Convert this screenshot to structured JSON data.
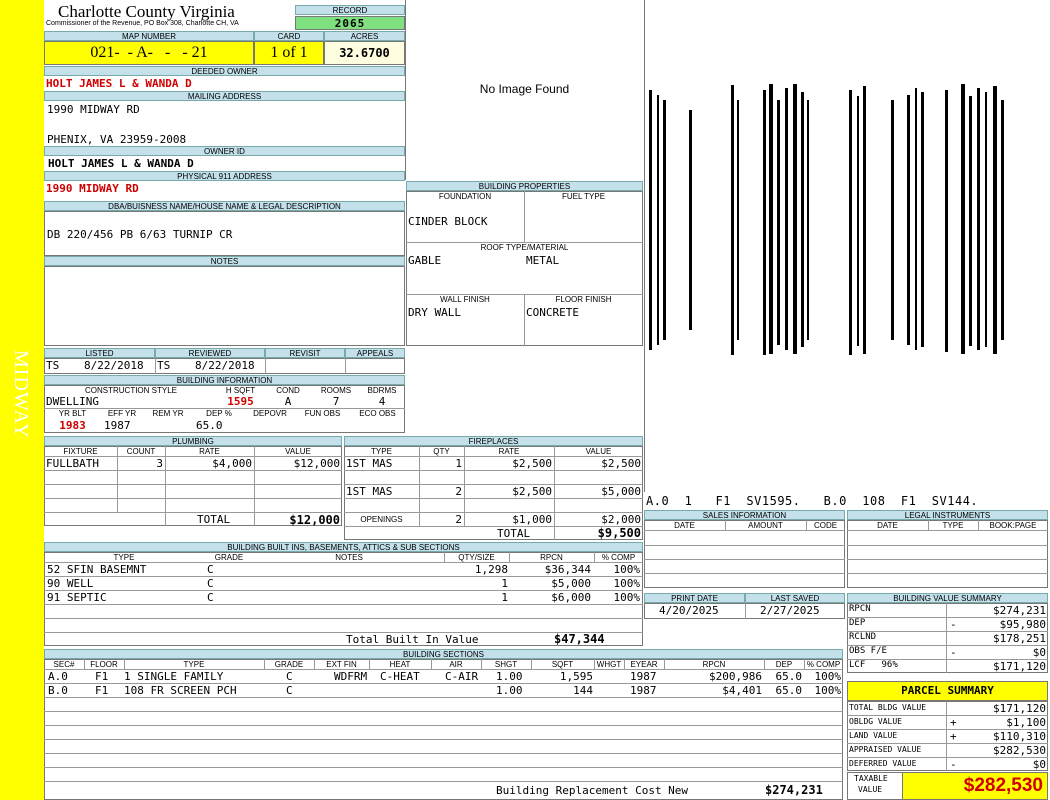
{
  "sidebar": {
    "label": "MIDWAY"
  },
  "header": {
    "title": "Charlotte County Virginia",
    "subtitle": "Commissioner of the Revenue, PO Box 308, Charlotte CH, VA",
    "record_label": "RECORD",
    "record_value": "2065"
  },
  "map": {
    "map_number_label": "MAP NUMBER",
    "map_number": "021-  - A-   -   - 21",
    "card_label": "CARD",
    "card": "1 of 1",
    "acres_label": "ACRES",
    "acres": "32.6700"
  },
  "owner": {
    "deeded_label": "DEEDED OWNER",
    "deeded": "HOLT JAMES L & WANDA D",
    "mailing_label": "MAILING ADDRESS",
    "mailing_line1": "1990 MIDWAY RD",
    "mailing_line2": "PHENIX, VA 23959-2008",
    "owner_id_label": "OWNER ID",
    "owner_id": "HOLT JAMES L & WANDA D",
    "physical_label": "PHYSICAL 911 ADDRESS",
    "physical": "1990 MIDWAY RD"
  },
  "legal": {
    "label": "DBA/BUISNESS NAME/HOUSE NAME & LEGAL DESCRIPTION",
    "text": "DB 220/456 PB 6/63 TURNIP CR"
  },
  "notes": {
    "label": "NOTES"
  },
  "image": {
    "placeholder": "No Image Found"
  },
  "props": {
    "title": "BUILDING PROPERTIES",
    "foundation_label": "FOUNDATION",
    "fuel_label": "FUEL TYPE",
    "foundation": "CINDER BLOCK",
    "roof_label": "ROOF TYPE/MATERIAL",
    "roof_type": "GABLE",
    "roof_material": "METAL",
    "wall_label": "WALL FINISH",
    "floor_label": "FLOOR FINISH",
    "wall": "DRY WALL",
    "floor": "CONCRETE"
  },
  "review": {
    "listed_label": "LISTED",
    "reviewed_label": "REVIEWED",
    "revisit_label": "REVISIT",
    "appeals_label": "APPEALS",
    "listed_by": "TS",
    "listed_date": "8/22/2018",
    "reviewed_by": "TS",
    "reviewed_date": "8/22/2018"
  },
  "building_info": {
    "title": "BUILDING INFORMATION",
    "style_label": "CONSTRUCTION STYLE",
    "hsqft_label": "H SQFT",
    "cond_label": "COND",
    "rooms_label": "ROOMS",
    "bdrms_label": "BDRMS",
    "style": "DWELLING",
    "hsqft": "1595",
    "cond": "A",
    "rooms": "7",
    "bdrms": "4",
    "yrblt_label": "YR BLT",
    "effyr_label": "EFF YR",
    "remyr_label": "REM YR",
    "dep_label": "DEP %",
    "depovr_label": "DEPOVR",
    "funobs_label": "FUN OBS",
    "ecoobs_label": "ECO OBS",
    "yrblt": "1983",
    "effyr": "1987",
    "dep": "65.0"
  },
  "plumbing": {
    "title": "PLUMBING",
    "headers": [
      "FIXTURE",
      "COUNT",
      "RATE",
      "VALUE"
    ],
    "rows": [
      [
        "FULLBATH",
        "3",
        "$4,000",
        "$12,000"
      ]
    ],
    "total_label": "TOTAL",
    "total": "$12,000"
  },
  "fireplaces": {
    "title": "FIREPLACES",
    "headers": [
      "TYPE",
      "QTY",
      "RATE",
      "VALUE"
    ],
    "rows": [
      [
        "1ST MAS",
        "1",
        "$2,500",
        "$2,500"
      ],
      [
        "1ST MAS",
        "2",
        "$2,500",
        "$5,000"
      ]
    ],
    "openings_label": "OPENINGS",
    "openings": [
      "2",
      "$1,000",
      "$2,000"
    ],
    "total_label": "TOTAL",
    "total": "$9,500"
  },
  "barcode": {
    "caption": "A.0  1   F1  SV1595.   B.0  108  F1  SV144."
  },
  "sales": {
    "title": "SALES INFORMATION",
    "headers": [
      "DATE",
      "AMOUNT",
      "CODE"
    ]
  },
  "legal_instr": {
    "title": "LEGAL INSTRUMENTS",
    "headers": [
      "DATE",
      "TYPE",
      "BOOK:PAGE"
    ]
  },
  "builtins": {
    "title": "BUILDING BUILT INS, BASEMENTS, ATTICS & SUB SECTIONS",
    "headers": [
      "TYPE",
      "GRADE",
      "NOTES",
      "QTY/SIZE",
      "RPCN",
      "% COMP"
    ],
    "rows": [
      [
        "52 SFIN BASEMNT",
        "C",
        "",
        "1,298",
        "$36,344",
        "100%"
      ],
      [
        "90 WELL",
        "C",
        "",
        "1",
        "$5,000",
        "100%"
      ],
      [
        "91 SEPTIC",
        "C",
        "",
        "1",
        "$6,000",
        "100%"
      ]
    ],
    "total_label": "Total Built In Value",
    "total": "$47,344"
  },
  "dates": {
    "print_label": "PRINT DATE",
    "saved_label": "LAST SAVED",
    "print": "4/20/2025",
    "saved": "2/27/2025"
  },
  "value_summary": {
    "title": "BUILDING VALUE SUMMARY",
    "rows": [
      [
        "RPCN",
        "",
        "$274,231"
      ],
      [
        "DEP",
        "-",
        "$95,980"
      ],
      [
        "RCLND",
        "",
        "$178,251"
      ],
      [
        "OBS F/E",
        "-",
        "$0"
      ],
      [
        "LCF   96%",
        "",
        "$171,120"
      ]
    ]
  },
  "sections": {
    "title": "BUILDING SECTIONS",
    "headers": [
      "SEC#",
      "FLOOR",
      "TYPE",
      "GRADE",
      "EXT FIN",
      "HEAT",
      "AIR",
      "SHGT",
      "SQFT",
      "WHGT",
      "EYEAR",
      "RPCN",
      "DEP",
      "% COMP"
    ],
    "rows": [
      [
        "A.0",
        "F1",
        "1 SINGLE FAMILY",
        "C",
        "WDFRM",
        "C-HEAT",
        "C-AIR",
        "1.00",
        "1,595",
        "",
        "1987",
        "$200,986",
        "65.0",
        "100%"
      ],
      [
        "B.0",
        "F1",
        "108 FR SCREEN PCH",
        "C",
        "",
        "",
        "",
        "1.00",
        "144",
        "",
        "1987",
        "$4,401",
        "65.0",
        "100%"
      ]
    ],
    "total_label": "Building Replacement Cost New",
    "total": "$274,231"
  },
  "parcel": {
    "title": "PARCEL SUMMARY",
    "rows": [
      [
        "TOTAL BLDG VALUE",
        "",
        "$171,120"
      ],
      [
        "OBLDG VALUE",
        "+",
        "$1,100"
      ],
      [
        "LAND VALUE",
        "+",
        "$110,310"
      ],
      [
        "APPRAISED VALUE",
        "",
        "$282,530"
      ],
      [
        "DEFERRED VALUE",
        "-",
        "$0"
      ]
    ],
    "taxable_label1": "TAXABLE",
    "taxable_label2": "VALUE",
    "taxable": "$282,530"
  },
  "colors": {
    "accent_yellow": "#ffff00",
    "header_blue": "#c4e0ea",
    "record_green": "#7fe07f",
    "value_red": "#d00000"
  }
}
